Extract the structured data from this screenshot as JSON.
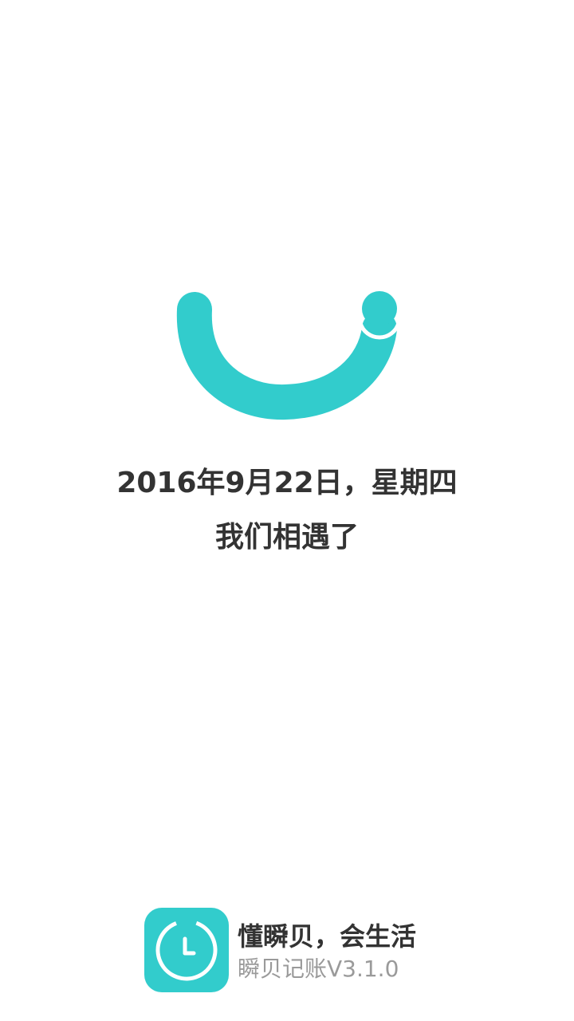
{
  "splash": {
    "date_line": "2016年9月22日，星期四",
    "tagline": "我们相遇了"
  },
  "footer": {
    "slogan": "懂瞬贝，会生活",
    "version": "瞬贝记账V3.1.0"
  },
  "colors": {
    "brand": "#32cccc",
    "text_dark": "#333333",
    "text_muted": "#9a9a9a"
  }
}
